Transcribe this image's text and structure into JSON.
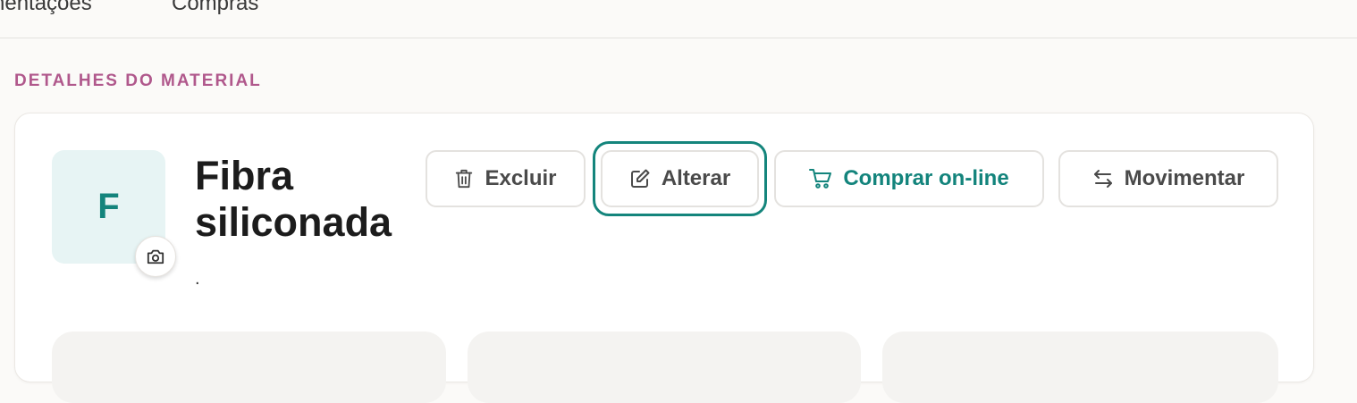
{
  "nav": {
    "tabs": [
      {
        "label": "nentações"
      },
      {
        "label": "Compras"
      }
    ]
  },
  "section": {
    "label": "DETALHES DO MATERIAL"
  },
  "material": {
    "avatar_letter": "F",
    "title": "Fibra siliconada",
    "subtitle": "."
  },
  "actions": {
    "delete_label": "Excluir",
    "edit_label": "Alterar",
    "buy_label": "Comprar on-line",
    "move_label": "Movimentar"
  },
  "icons": {
    "camera": "camera-icon",
    "trash": "trash-icon",
    "edit": "edit-icon",
    "cart": "cart-icon",
    "arrows": "swap-arrows-icon"
  },
  "colors": {
    "accent": "#13847c",
    "section_label": "#b0588c",
    "avatar_bg": "#e7f4f4"
  }
}
